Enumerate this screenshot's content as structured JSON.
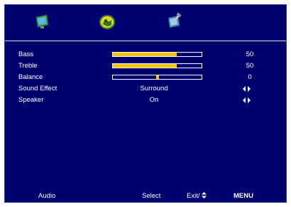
{
  "tabs": [
    {
      "name": "Picture",
      "icon": "picture-icon"
    },
    {
      "name": "Audio",
      "icon": "audio-icon",
      "active": true
    },
    {
      "name": "Setup",
      "icon": "setup-icon"
    }
  ],
  "settings": {
    "bass": {
      "label": "Bass",
      "value": "50",
      "level": 0.72
    },
    "treble": {
      "label": "Treble",
      "value": "50",
      "level": 0.72
    },
    "balance": {
      "label": "Balance",
      "value": "0",
      "position": 0.5
    },
    "sound_effect": {
      "label": "Sound Effect",
      "value": "Surround"
    },
    "speaker": {
      "label": "Speaker",
      "value": "On"
    }
  },
  "footer": {
    "section": "Audio",
    "select": "Select",
    "exit": "Exit/",
    "menu": "MENU"
  },
  "colors": {
    "background": "#00006e",
    "accent": "#f5c400",
    "text": "#ffffff"
  }
}
